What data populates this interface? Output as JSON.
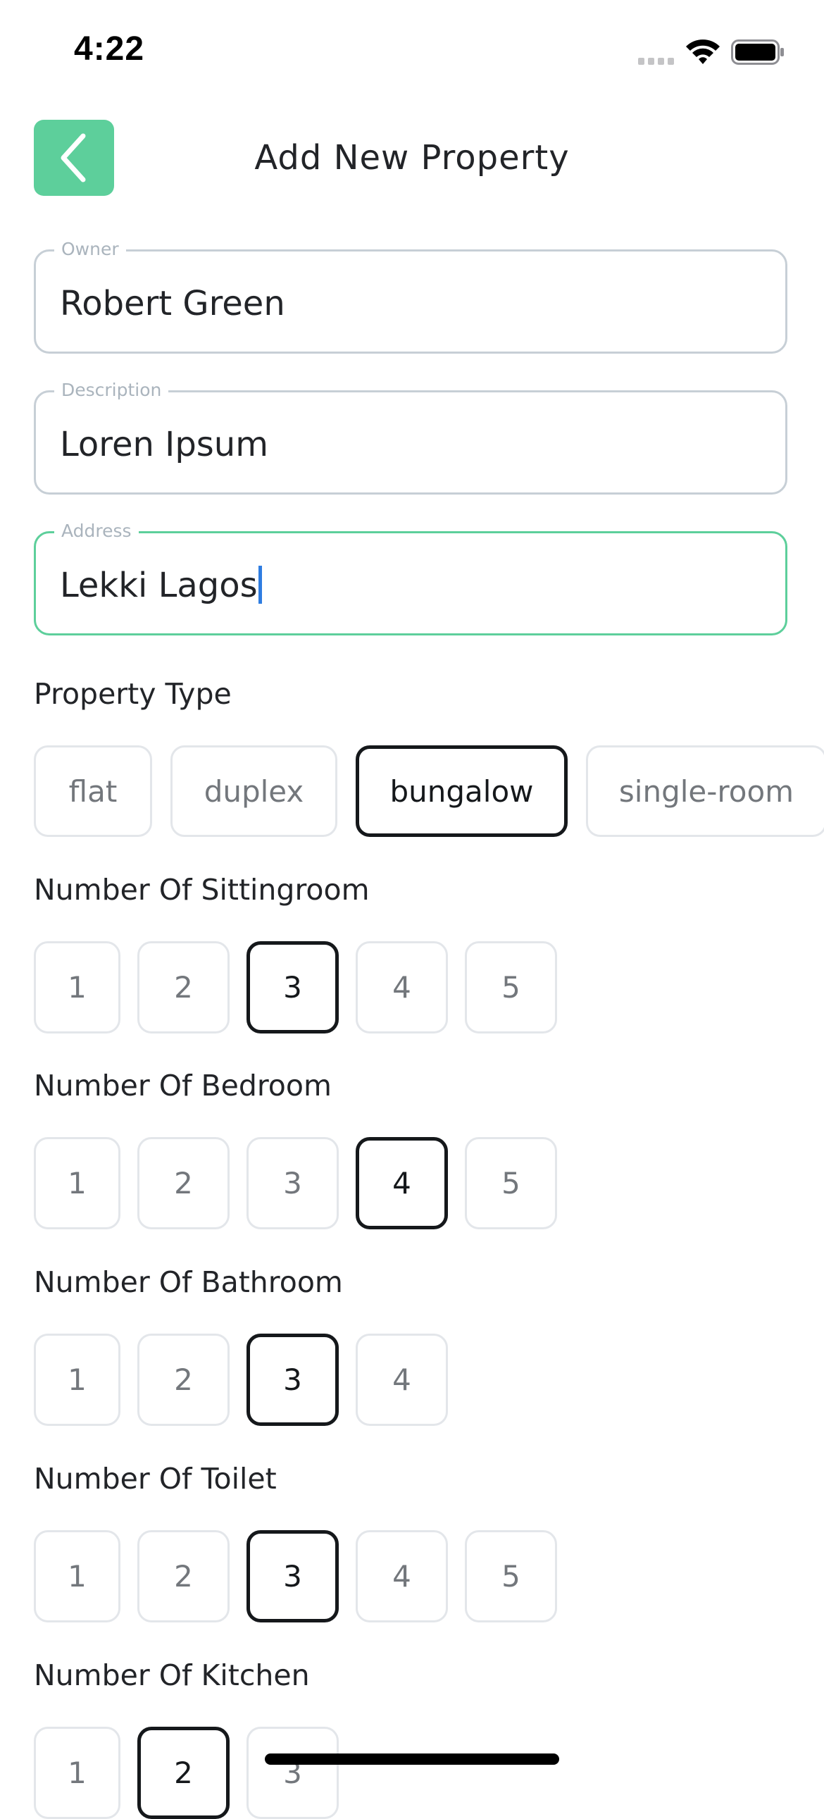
{
  "status_bar": {
    "time": "4:22"
  },
  "header": {
    "title": "Add New Property",
    "back_icon": "chevron-left-icon"
  },
  "colors": {
    "accent": "#5dcf9b",
    "selected_border": "#15181b",
    "caret": "#2f7de1"
  },
  "fields": {
    "owner": {
      "label": "Owner",
      "value": "Robert Green"
    },
    "description": {
      "label": "Description",
      "value": "Loren Ipsum"
    },
    "address": {
      "label": "Address",
      "value": "Lekki Lagos",
      "focused": true
    }
  },
  "property_type": {
    "label": "Property Type",
    "options": [
      "flat",
      "duplex",
      "bungalow",
      "single-room"
    ],
    "selected": "bungalow"
  },
  "sittingroom": {
    "label": "Number Of Sittingroom",
    "options": [
      "1",
      "2",
      "3",
      "4",
      "5"
    ],
    "selected": "3"
  },
  "bedroom": {
    "label": "Number Of Bedroom",
    "options": [
      "1",
      "2",
      "3",
      "4",
      "5"
    ],
    "selected": "4"
  },
  "bathroom": {
    "label": "Number Of Bathroom",
    "options": [
      "1",
      "2",
      "3",
      "4"
    ],
    "selected": "3"
  },
  "toilet": {
    "label": "Number Of Toilet",
    "options": [
      "1",
      "2",
      "3",
      "4",
      "5"
    ],
    "selected": "3"
  },
  "kitchen": {
    "label": "Number Of Kitchen",
    "options": [
      "1",
      "2",
      "3"
    ],
    "selected": "2"
  }
}
